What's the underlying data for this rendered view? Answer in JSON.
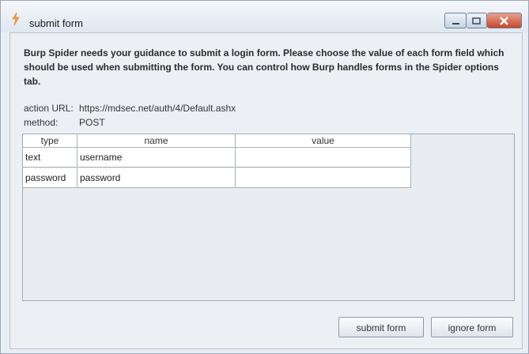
{
  "window": {
    "title": "submit form",
    "icon": "burp-flame-icon",
    "controls": [
      "minimize",
      "maximize",
      "close"
    ]
  },
  "instructions": "Burp Spider needs your guidance to submit a login form. Please choose the value of each form field which should be used when submitting the form. You can control how Burp handles forms in the Spider options tab.",
  "form_info": {
    "action_label": "action URL:",
    "action_value": "https://mdsec.net/auth/4/Default.ashx",
    "method_label": "method:",
    "method_value": "POST"
  },
  "table": {
    "headers": [
      "type",
      "name",
      "value"
    ],
    "rows": [
      {
        "type": "text",
        "name": "username",
        "value": ""
      },
      {
        "type": "password",
        "name": "password",
        "value": ""
      }
    ]
  },
  "buttons": {
    "submit": "submit form",
    "ignore": "ignore form"
  },
  "colors": {
    "close_button": "#c6462d",
    "window_bg": "#eceff3"
  }
}
